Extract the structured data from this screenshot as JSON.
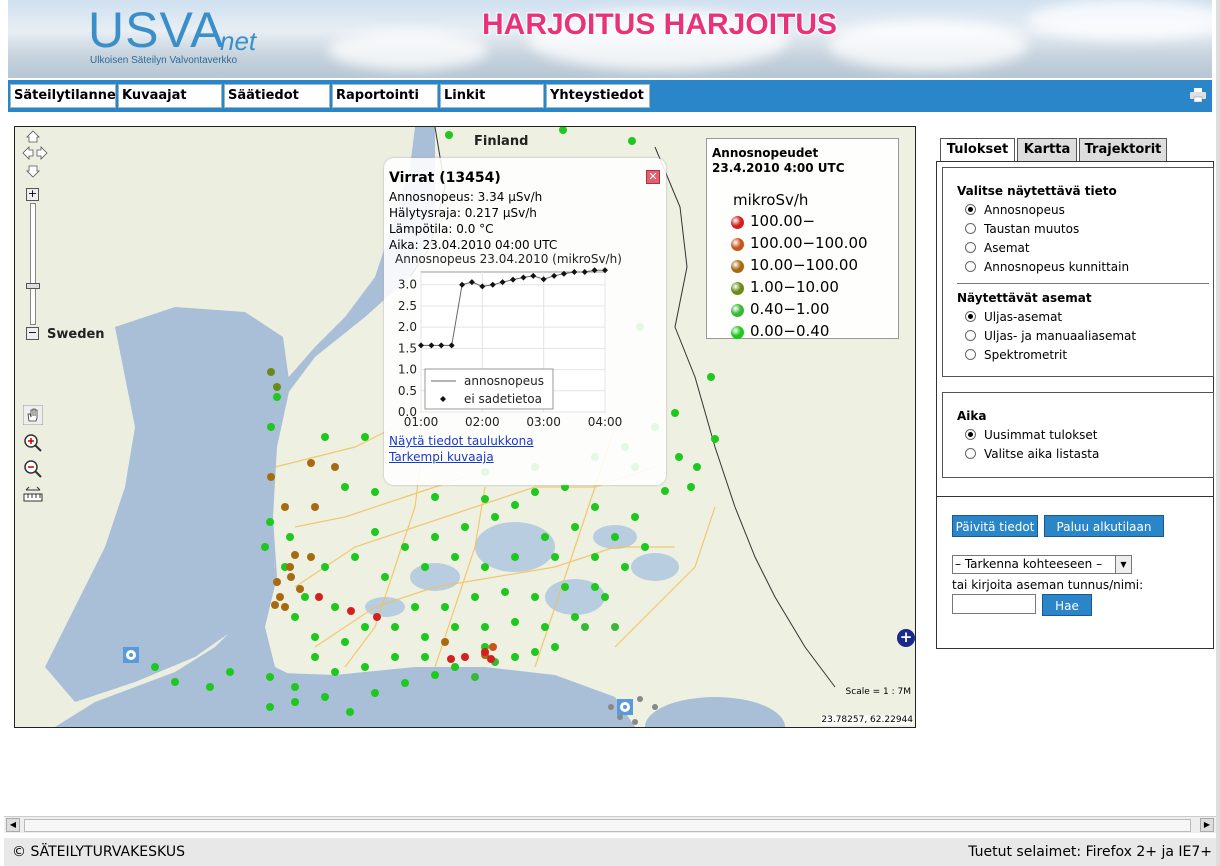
{
  "header": {
    "logo": "USVA",
    "logo_suffix": "net",
    "logo_subtitle": "Ulkoisen Säteilyn Valvontaverkko",
    "banner": "HARJOITUS HARJOITUS"
  },
  "nav": {
    "items": [
      "Säteilytilanne",
      "Kuvaajat",
      "Säätiedot",
      "Raportointi",
      "Linkit",
      "Yhteystiedot"
    ]
  },
  "map": {
    "labels": {
      "finland": "Finland",
      "sweden": "Sweden"
    },
    "scale": "Scale = 1 : 7M",
    "coordinates": "23.78257, 62.22944",
    "status_colors": {
      "very_high": "#d42020",
      "high": "#c8561a",
      "elevated": "#a86a10",
      "raised": "#6a8a18",
      "normal": "#38b838",
      "low": "#1ec81e"
    }
  },
  "popup": {
    "title": "Virrat (13454)",
    "dose_rate": "Annosnopeus: 3.34 µSv/h",
    "alarm_limit": "Hälytysraja: 0.217 µSv/h",
    "temperature": "Lämpötila: 0.0 °C",
    "time": "Aika: 23.04.2010 04:00 UTC",
    "link_table": "Näytä tiedot taulukkona",
    "link_chart": "Tarkempi kuvaaja",
    "close_icon": "close-icon"
  },
  "chart_data": {
    "type": "line",
    "title": "Annosnopeus 23.04.2010 (mikroSv/h)",
    "xlabel": "",
    "ylabel": "",
    "x_ticks": [
      "01:00",
      "02:00",
      "03:00",
      "04:00"
    ],
    "y_ticks": [
      "0.0",
      "0.5",
      "1.0",
      "1.5",
      "2.0",
      "2.5",
      "3.0"
    ],
    "ylim": [
      0,
      3.3
    ],
    "xlim": [
      1.0,
      4.0
    ],
    "x": [
      1.0,
      1.17,
      1.33,
      1.5,
      1.67,
      1.83,
      2.0,
      2.17,
      2.33,
      2.5,
      2.67,
      2.83,
      3.0,
      3.17,
      3.33,
      3.5,
      3.67,
      3.83,
      4.0
    ],
    "values": [
      1.57,
      1.57,
      1.57,
      1.57,
      3.0,
      3.06,
      2.96,
      3.0,
      3.06,
      3.12,
      3.17,
      3.21,
      3.13,
      3.21,
      3.26,
      3.3,
      3.3,
      3.34,
      3.34
    ],
    "series": [
      {
        "name": "annosnopeus"
      },
      {
        "name": "ei sadetietoa"
      }
    ],
    "legend": "bottom-left",
    "grid": true
  },
  "legend": {
    "title": "Annosnopeudet",
    "date": "23.4.2010 4:00 UTC",
    "unit": "mikroSv/h",
    "rows": [
      {
        "label": "100.00−",
        "color": "#d42020"
      },
      {
        "label": "100.00−100.00",
        "color": "#c8561a"
      },
      {
        "label": "10.00−100.00",
        "color": "#a86a10"
      },
      {
        "label": "1.00−10.00",
        "color": "#6a8a18"
      },
      {
        "label": "0.40−1.00",
        "color": "#38b838"
      },
      {
        "label": "0.00−0.40",
        "color": "#1ec81e"
      }
    ]
  },
  "tabs": [
    "Tulokset",
    "Kartta",
    "Trajektorit"
  ],
  "results": {
    "info_title": "Valitse näytettävä tieto",
    "info_options": [
      "Annosnopeus",
      "Taustan muutos",
      "Asemat",
      "Annosnopeus kunnittain"
    ],
    "stations_title": "Näytettävät asemat",
    "station_options": [
      "Uljas-asemat",
      "Uljas- ja manuaaliasemat",
      "Spektrometrit"
    ],
    "time_title": "Aika",
    "time_options": [
      "Uusimmat tulokset",
      "Valitse aika listasta"
    ]
  },
  "actions": {
    "refresh": "Päivitä tiedot",
    "reset": "Paluu alkutilaan",
    "select_value": "– Tarkenna kohteeseen –",
    "hint": "tai kirjoita aseman tunnus/nimi:",
    "search": "Hae"
  },
  "footer": {
    "copyright": "© SÄTEILYTURVAKESKUS",
    "browsers": "Tuetut selaimet: Firefox 2+ ja IE7+"
  }
}
